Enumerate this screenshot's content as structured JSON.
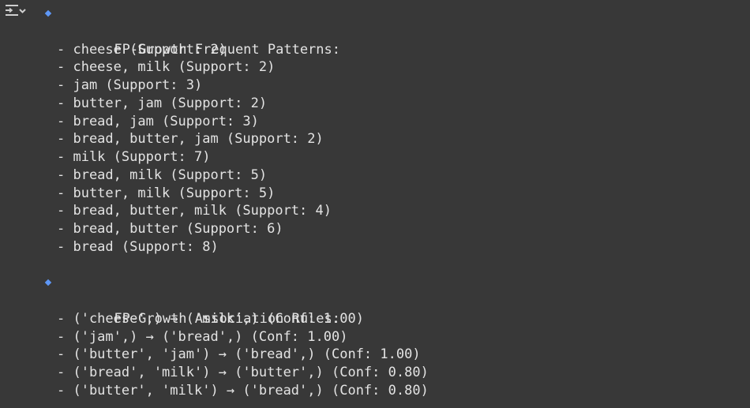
{
  "output": {
    "toggle_icon": "output-collapse-icon",
    "bullet_color": "#5e97f6",
    "patterns_title": "FP-Growth Frequent Patterns:",
    "patterns": [
      "- cheese (Support: 2)",
      "- cheese, milk (Support: 2)",
      "- jam (Support: 3)",
      "- butter, jam (Support: 2)",
      "- bread, jam (Support: 3)",
      "- bread, butter, jam (Support: 2)",
      "- milk (Support: 7)",
      "- bread, milk (Support: 5)",
      "- butter, milk (Support: 5)",
      "- bread, butter, milk (Support: 4)",
      "- bread, butter (Support: 6)",
      "- bread (Support: 8)"
    ],
    "rules_title": "FP-Growth Association Rules:",
    "rules": [
      "- ('cheese',) → ('milk',) (Conf: 1.00)",
      "- ('jam',) → ('bread',) (Conf: 1.00)",
      "- ('butter', 'jam') → ('bread',) (Conf: 1.00)",
      "- ('bread', 'milk') → ('butter',) (Conf: 0.80)",
      "- ('butter', 'milk') → ('bread',) (Conf: 0.80)"
    ]
  }
}
